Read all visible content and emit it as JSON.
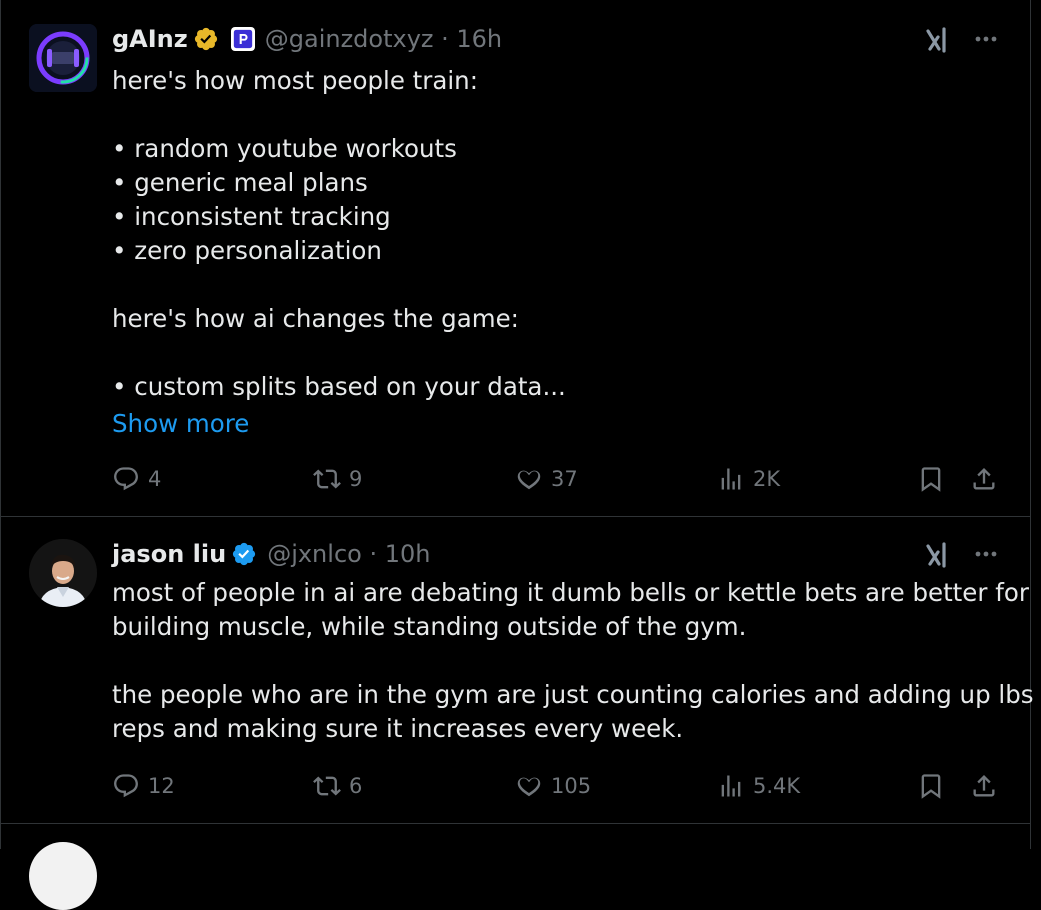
{
  "tweets": [
    {
      "name": "gAInz",
      "handle": "@gainzdotxyz",
      "time": "16h",
      "handle_time": "@gainzdotxyz · 16h",
      "lines": [
        "here's how most people train:",
        "",
        "• random youtube workouts",
        "• generic meal plans",
        "• inconsistent tracking",
        "• zero personalization",
        "",
        "here's how ai changes the game:",
        "",
        "• custom splits based on your data..."
      ],
      "show_more": "Show more",
      "stats": {
        "replies": "4",
        "reposts": "9",
        "likes": "37",
        "views": "2K"
      }
    },
    {
      "name": "jason liu",
      "handle": "@jxnlco",
      "time": "10h",
      "handle_time": "@jxnlco · 10h",
      "lines": [
        "most of people in ai are debating it dumb bells or kettle bets are better for",
        "building muscle, while standing outside of the gym.",
        "",
        "the people who are in the gym are just counting calories and adding up lbs *",
        "reps and making sure it increases every week."
      ],
      "stats": {
        "replies": "12",
        "reposts": "6",
        "likes": "105",
        "views": "5.4K"
      }
    }
  ],
  "icons": {
    "verified": "verified-badge-icon",
    "affiliate": "affiliate-badge-icon",
    "grok": "grok-icon",
    "more": "more-icon",
    "reply": "reply-icon",
    "repost": "repost-icon",
    "like": "like-icon",
    "views": "views-icon",
    "bookmark": "bookmark-icon",
    "share": "share-icon"
  },
  "colors": {
    "background": "#000000",
    "text": "#e7e9ea",
    "muted": "#71767b",
    "link": "#1d9bf0",
    "border": "#2f3336",
    "gold_badge": "#e8b829",
    "blue_badge": "#1d9bf0"
  }
}
